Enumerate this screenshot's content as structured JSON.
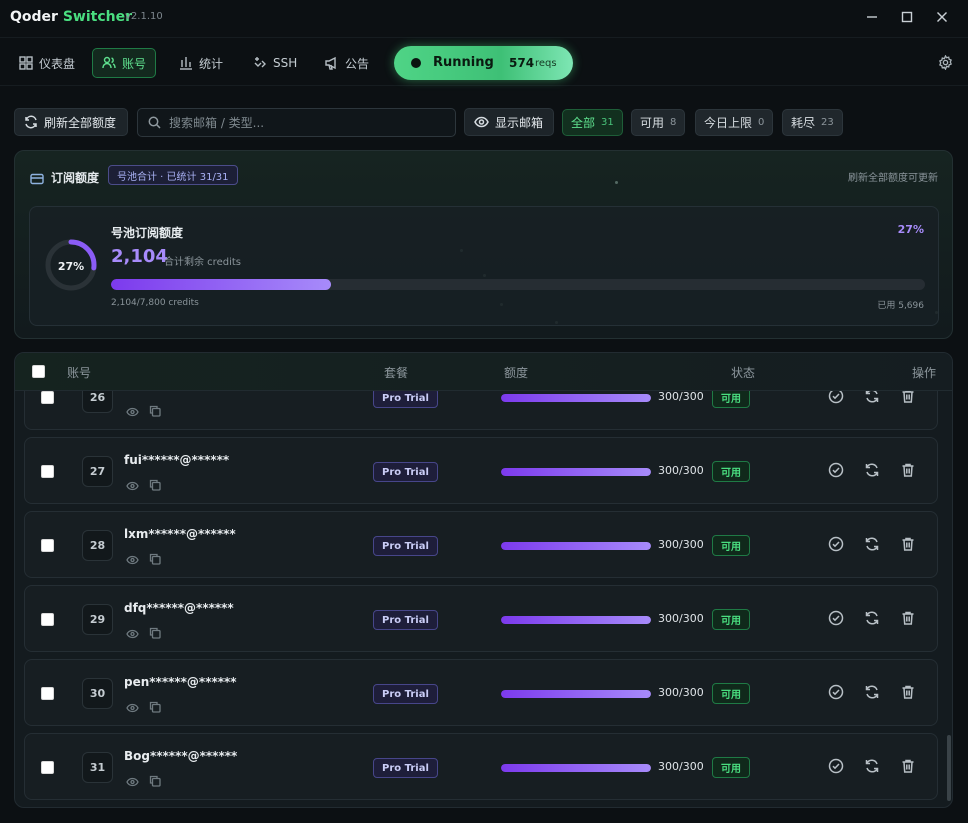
{
  "app": {
    "title_part1": "Qoder",
    "title_part2": "Switcher",
    "version": "v2.1.10"
  },
  "nav": {
    "tabs": [
      {
        "label": "仪表盘",
        "icon": "dashboard-icon"
      },
      {
        "label": "账号",
        "icon": "users-icon",
        "active": true
      },
      {
        "label": "统计",
        "icon": "bar-chart-icon"
      },
      {
        "label": "SSH",
        "icon": "ssh-icon"
      },
      {
        "label": "公告",
        "icon": "megaphone-icon"
      }
    ],
    "running": {
      "label": "Running",
      "count": "574",
      "unit": "reqs"
    }
  },
  "toolbar": {
    "refresh_label": "刷新全部额度",
    "search_placeholder": "搜索邮箱 / 类型...",
    "show_email_label": "显示邮箱",
    "filters": [
      {
        "label": "全部",
        "count": "31",
        "active": true
      },
      {
        "label": "可用",
        "count": "8"
      },
      {
        "label": "今日上限",
        "count": "0"
      },
      {
        "label": "耗尽",
        "count": "23"
      }
    ]
  },
  "subscription": {
    "title": "订阅额度",
    "badge": "号池合计 · 已统计 31/31",
    "hint": "刷新全部额度可更新",
    "card": {
      "title": "号池订阅额度",
      "remaining": "2,104",
      "remaining_unit": "合计剩余 credits",
      "percent_label": "27%",
      "percent_value": 27,
      "used_total": "2,104/7,800 credits",
      "used": "已用 5,696"
    }
  },
  "table": {
    "headers": {
      "account": "账号",
      "plan": "套餐",
      "quota": "额度",
      "status": "状态",
      "actions": "操作"
    },
    "rows": [
      {
        "index": "26",
        "email": "",
        "plan": "Pro Trial",
        "credits": "300/300",
        "fill": 1.0,
        "status": "可用"
      },
      {
        "index": "27",
        "email": "fui******@******",
        "plan": "Pro Trial",
        "credits": "300/300",
        "fill": 1.0,
        "status": "可用"
      },
      {
        "index": "28",
        "email": "lxm******@******",
        "plan": "Pro Trial",
        "credits": "300/300",
        "fill": 1.0,
        "status": "可用"
      },
      {
        "index": "29",
        "email": "dfq******@******",
        "plan": "Pro Trial",
        "credits": "300/300",
        "fill": 1.0,
        "status": "可用"
      },
      {
        "index": "30",
        "email": "pen******@******",
        "plan": "Pro Trial",
        "credits": "300/300",
        "fill": 1.0,
        "status": "可用"
      },
      {
        "index": "31",
        "email": "Bog******@******",
        "plan": "Pro Trial",
        "credits": "300/300",
        "fill": 1.0,
        "status": "可用"
      }
    ]
  },
  "colors": {
    "accent": "#4ade80",
    "purple": "#a78bfa",
    "bg": "#0c1013"
  }
}
